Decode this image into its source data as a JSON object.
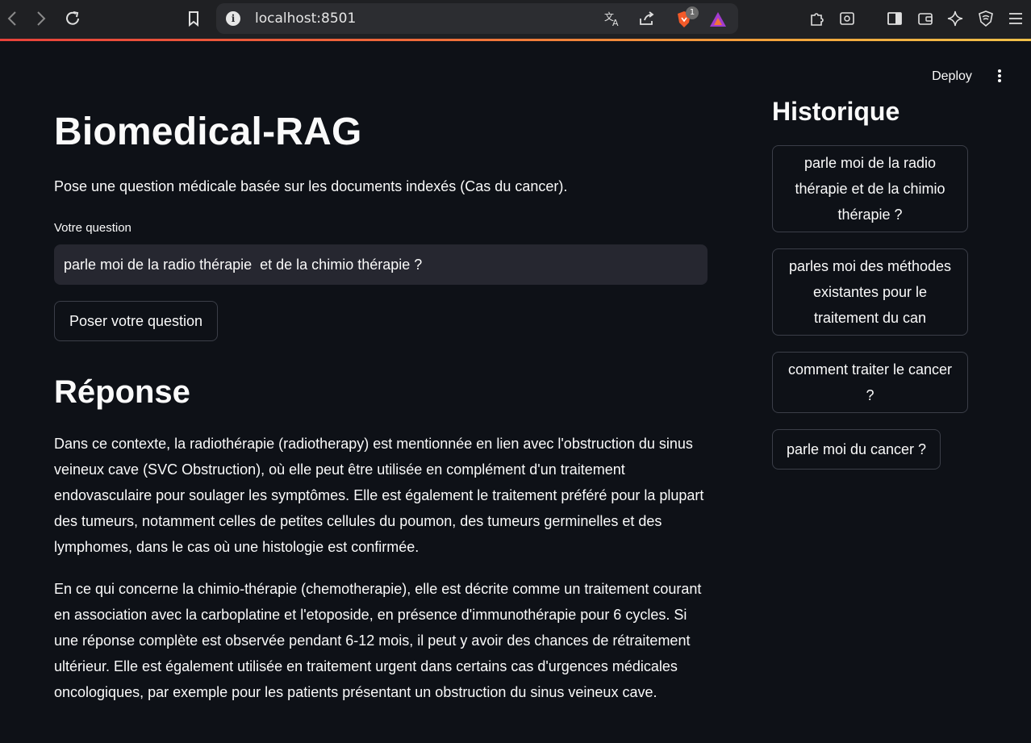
{
  "browser": {
    "url": "localhost:8501",
    "shield_badge_count": "1",
    "icons": [
      "back-icon",
      "forward-icon",
      "reload-icon",
      "bookmark-icon",
      "info-icon",
      "translate-icon",
      "share-icon",
      "brave-shield-icon",
      "brave-rewards-icon",
      "extensions-icon",
      "reader-mode-icon",
      "sidebar-icon",
      "wallet-icon",
      "leo-ai-icon",
      "vpn-icon",
      "menu-icon"
    ]
  },
  "header": {
    "deploy_label": "Deploy"
  },
  "main": {
    "title": "Biomedical-RAG",
    "subtitle": "Pose une question médicale basée sur les documents indexés (Cas du cancer).",
    "question_label": "Votre question",
    "question_value": "parle moi de la radio thérapie  et de la chimio thérapie ?",
    "ask_button_label": "Poser votre question",
    "response_title": "Réponse",
    "response_paragraphs": [
      "Dans ce contexte, la radiothérapie (radiotherapy) est mentionnée en lien avec l'obstruction du sinus veineux cave (SVC Obstruction), où elle peut être utilisée en complément d'un traitement endovasculaire pour soulager les symptômes. Elle est également le traitement préféré pour la plupart des tumeurs, notamment celles de petites cellules du poumon, des tumeurs germinelles et des lymphomes, dans le cas où une histologie est confirmée.",
      "En ce qui concerne la chimio-thérapie (chemotherapie), elle est décrite comme un traitement courant en association avec la carboplatine et l'etoposide, en présence d'immunothérapie pour 6 cycles. Si une réponse complète est observée pendant 6-12 mois, il peut y avoir des chances de rétraitement ultérieur. Elle est également utilisée en traitement urgent dans certains cas d'urgences médicales oncologiques, par exemple pour les patients présentant un obstruction du sinus veineux cave."
    ]
  },
  "history": {
    "title": "Historique",
    "items": [
      "parle moi de la radio thérapie et de la chimio thérapie ?",
      "parles moi des méthodes existantes pour le traitement du can",
      "comment traiter le cancer ?",
      "parle moi du cancer ?"
    ]
  },
  "colors": {
    "background": "#0e1117",
    "input_background": "#262730",
    "border": "#3b3e48",
    "text": "#fafafa"
  }
}
